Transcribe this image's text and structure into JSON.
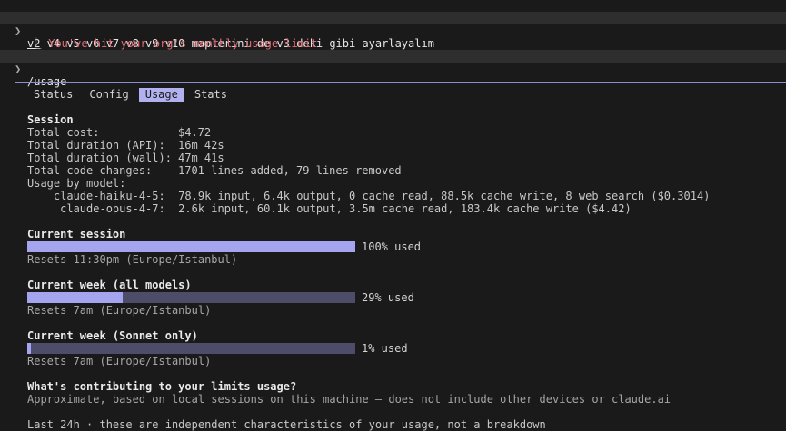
{
  "prompt1": {
    "chevron": "❯",
    "cmd_underlined": "v2",
    "cmd_rest": " v4 v5 v6 v7 v8 v9 v10 maplerini de v3 deki gibi ayarlayalım",
    "error_branch": "⎿ ",
    "error_text": "You've hit your org's monthly usage limit"
  },
  "prompt2": {
    "chevron": "❯",
    "cmd": "/usage"
  },
  "tabs": [
    {
      "label": "Status"
    },
    {
      "label": "Config"
    },
    {
      "label": "Usage"
    },
    {
      "label": "Stats"
    }
  ],
  "session": {
    "heading": "Session",
    "rows": [
      {
        "label": "Total cost:",
        "value": "$4.72"
      },
      {
        "label": "Total duration (API):",
        "value": "16m 42s"
      },
      {
        "label": "Total duration (wall):",
        "value": "47m 41s"
      },
      {
        "label": "Total code changes:",
        "value": "1701 lines added, 79 lines removed"
      }
    ],
    "by_model_label": "Usage by model:",
    "models": [
      {
        "name": "    claude-haiku-4-5:",
        "value": "78.9k input, 6.4k output, 0 cache read, 88.5k cache write, 8 web search ($0.3014)"
      },
      {
        "name": "     claude-opus-4-7:",
        "value": "2.6k input, 60.1k output, 3.5m cache read, 183.4k cache write ($4.42)"
      }
    ]
  },
  "limits": [
    {
      "title": "Current session",
      "fraction": 1.0,
      "pct_text": "100% used",
      "reset": "Resets 11:30pm (Europe/Istanbul)"
    },
    {
      "title": "Current week (all models)",
      "fraction": 0.29,
      "pct_text": "29% used",
      "reset": "Resets 7am (Europe/Istanbul)"
    },
    {
      "title": "Current week (Sonnet only)",
      "fraction": 0.01,
      "pct_text": "1% used",
      "reset": "Resets 7am (Europe/Istanbul)"
    }
  ],
  "contrib": {
    "heading": "What's contributing to your limits usage?",
    "note": "Approximate, based on local sessions on this machine — does not include other devices or claude.ai",
    "cutoff": "Last 24h · these are independent characteristics of your usage, not a breakdown"
  }
}
